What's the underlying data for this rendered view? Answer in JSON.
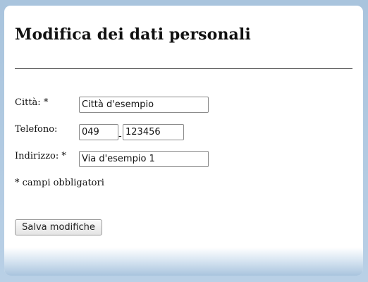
{
  "form": {
    "title": "Modifica dei dati personali",
    "city": {
      "label": "Città: *",
      "value": "Città d'esempio"
    },
    "phone": {
      "label": "Telefono:",
      "prefix_value": "049",
      "separator": "-",
      "number_value": "123456"
    },
    "address": {
      "label": "Indirizzo: *",
      "value": "Via d'esempio 1"
    },
    "required_note": "* campi obbligatori",
    "save_label": "Salva modifiche"
  }
}
